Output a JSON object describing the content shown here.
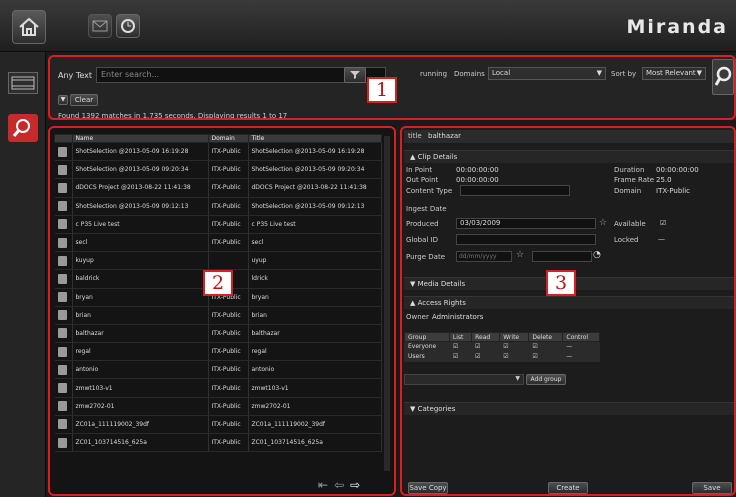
{
  "app": {
    "logo": "Miranda"
  },
  "colors": {
    "accent_red": "#d92020",
    "background": "#1a1a1a",
    "panel": "#242424"
  },
  "search": {
    "any_text_label": "Any Text",
    "placeholder": "Enter search...",
    "running_label": "running",
    "domains_label": "Domains",
    "domains_value": "Local",
    "sort_label": "Sort by",
    "sort_value": "Most Relevant",
    "clear_label": "Clear",
    "status": "Found 1392 matches in 1.735 seconds. Displaying results 1 to 17"
  },
  "annotations": [
    "1",
    "2",
    "3"
  ],
  "results": {
    "columns": [
      "Name",
      "Domain",
      "Title"
    ],
    "rows": [
      {
        "name": "ShotSelection @2013-05-09 16:19:28",
        "domain": "ITX-Public",
        "title": "ShotSelection @2013-05-09 16:19:28"
      },
      {
        "name": "ShotSelection @2013-05-09 09:20:34",
        "domain": "ITX-Public",
        "title": "ShotSelection @2013-05-09 09:20:34"
      },
      {
        "name": "dDOCS Project @2013-08-22 11:41:38",
        "domain": "ITX-Public",
        "title": "dDOCS Project @2013-08-22 11:41:38"
      },
      {
        "name": "ShotSelection @2013-05-09 09:12:13",
        "domain": "ITX-Public",
        "title": "ShotSelection @2013-05-09 09:12:13"
      },
      {
        "name": "c P35 Live test",
        "domain": "ITX-Public",
        "title": "c P35 Live test"
      },
      {
        "name": "secl",
        "domain": "ITX-Public",
        "title": "secl"
      },
      {
        "name": "kuyup",
        "domain": "",
        "title": "uyup"
      },
      {
        "name": "baldrick",
        "domain": "",
        "title": "ldrick"
      },
      {
        "name": "bryan",
        "domain": "ITX-Public",
        "title": "bryan"
      },
      {
        "name": "brian",
        "domain": "ITX-Public",
        "title": "brian"
      },
      {
        "name": "balthazar",
        "domain": "ITX-Public",
        "title": "balthazar"
      },
      {
        "name": "regal",
        "domain": "ITX-Public",
        "title": "regal"
      },
      {
        "name": "antonio",
        "domain": "ITX-Public",
        "title": "antonio"
      },
      {
        "name": "zmwt103-v1",
        "domain": "ITX-Public",
        "title": "zmwt103-v1"
      },
      {
        "name": "zmw2702-01",
        "domain": "ITX-Public",
        "title": "zmw2702-01"
      },
      {
        "name": "ZC01a_111119002_39df",
        "domain": "ITX-Public",
        "title": "ZC01a_111119002_39df"
      },
      {
        "name": "ZC01_103714516_625a",
        "domain": "ITX-Public",
        "title": "ZC01_103714516_625a"
      }
    ]
  },
  "details": {
    "title_label": "title",
    "title_value": "balthazar",
    "clip_section": "Clip Details",
    "in_point_label": "In Point",
    "in_point_value": "00:00:00:00",
    "out_point_label": "Out Point",
    "out_point_value": "00:00:00:00",
    "duration_label": "Duration",
    "duration_value": "00:00:00:00",
    "frame_rate_label": "Frame Rate",
    "frame_rate_value": "25.0",
    "content_type_label": "Content Type",
    "domain_label": "Domain",
    "domain_value": "ITX-Public",
    "ingest_label": "Ingest Date",
    "produced_label": "Produced",
    "produced_value": "03/03/2009",
    "available_label": "Available",
    "global_id_label": "Global ID",
    "locked_label": "Locked",
    "purge_label": "Purge Date",
    "purge_placeholder": "dd/mm/yyyy",
    "media_section": "Media Details",
    "access_section": "Access Rights",
    "owner_label": "Owner",
    "owner_value": "Administrators",
    "access_columns": [
      "Group",
      "List",
      "Read",
      "Write",
      "Delete",
      "Control"
    ],
    "access_rows": [
      "Everyone",
      "Users"
    ],
    "add_group": "Add group",
    "categories_section": "Categories"
  },
  "footer": {
    "save_copy": "Save Copy",
    "create": "Create",
    "save": "Save"
  }
}
